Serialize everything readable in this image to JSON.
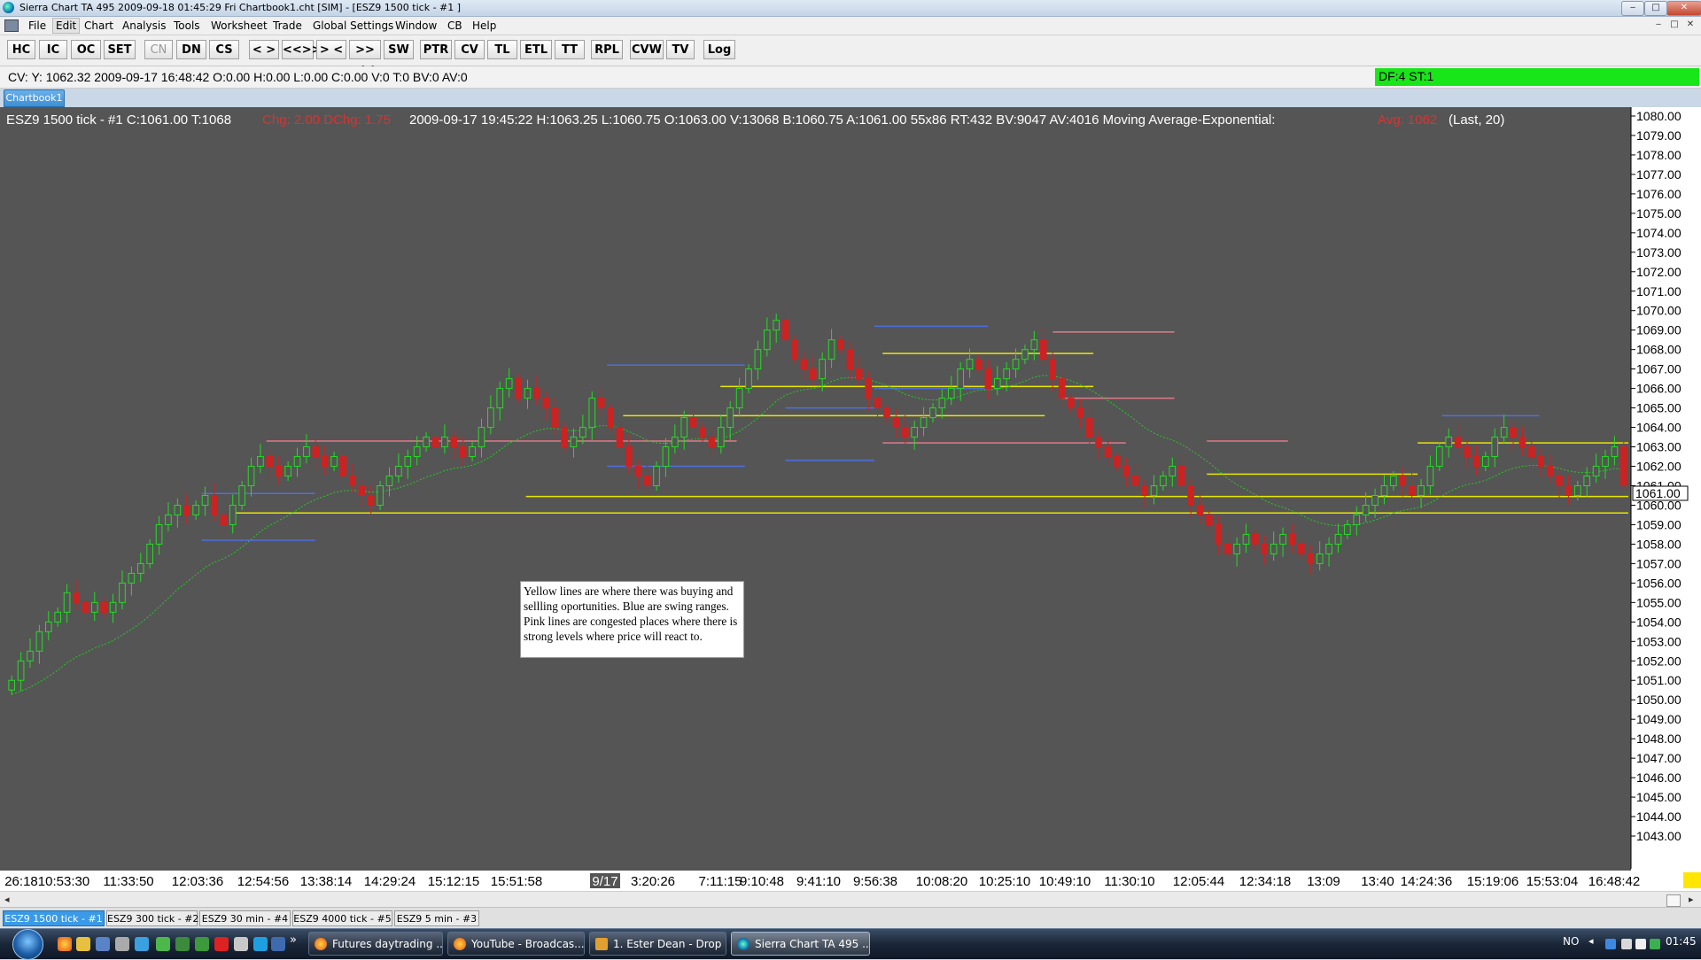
{
  "window": {
    "title": "Sierra Chart TA 495  2009-09-18  01:45:29  Fri   Chartbook1.cht [SIM] - [ESZ9  1500 tick - #1 ]",
    "controls": [
      "‒",
      "□",
      "✕"
    ]
  },
  "menu": [
    "File",
    "Edit",
    "Chart",
    "Analysis",
    "Tools",
    "Worksheet",
    "Trade",
    "Global Settings",
    "Window",
    "CB",
    "Help"
  ],
  "toolbar": {
    "buttons": [
      {
        "label": "HC",
        "enabled": true
      },
      {
        "label": "IC",
        "enabled": true
      },
      {
        "label": "OC",
        "enabled": true
      },
      {
        "label": "SET",
        "enabled": true
      },
      {
        "label": "CN",
        "enabled": false
      },
      {
        "label": "DN",
        "enabled": true
      },
      {
        "label": "CS",
        "enabled": true
      },
      {
        "label": "< >",
        "enabled": true
      },
      {
        "label": "<<>>",
        "enabled": true
      },
      {
        "label": "> <",
        "enabled": true
      },
      {
        "label": ">><<",
        "enabled": true
      },
      {
        "label": "SW",
        "enabled": true
      },
      {
        "label": "PTR",
        "enabled": true
      },
      {
        "label": "CV",
        "enabled": true
      },
      {
        "label": "TL",
        "enabled": true
      },
      {
        "label": "ETL",
        "enabled": true
      },
      {
        "label": "TT",
        "enabled": true
      },
      {
        "label": "RPL",
        "enabled": true
      },
      {
        "label": "CVW",
        "enabled": true
      },
      {
        "label": "TV",
        "enabled": true
      },
      {
        "label": "Log",
        "enabled": true
      }
    ]
  },
  "cursor_values": "CV: Y: 1062.32  2009-09-17   16:48:42  O:0.00  H:0.00  L:0.00  C:0.00  V:0  T:0  BV:0  AV:0",
  "status_indicator": "DF:4  ST:1",
  "chartbook_tab": "Chartbook1",
  "chart_header": {
    "symbol_info": "ESZ9  1500 tick - #1  C:1061.00  T:1068",
    "change": "Chg: 2.00  DChg: 1.75",
    "bar_info": "2009-09-17  19:45:22  H:1063.25  L:1060.75  O:1063.00  V:13068  B:1060.75  A:1061.00  55x86  RT:432  BV:9047  AV:4016  Moving Average-Exponential:",
    "study_value": "Avg: 1062",
    "study_params": "(Last, 20)"
  },
  "annotation": "Yellow lines are where there was buying and sellling oportunities. Blue are swing ranges. Pink lines are congested places where there is strong levels where price will react to.",
  "current_price_label": "1061.00",
  "colors": {
    "background": "#555555",
    "up_candle": "#22dd22",
    "down_candle": "#cc2222",
    "moving_average": "#22cc22",
    "yellow_lines": "#e6e600",
    "blue_lines": "#4d6fe0",
    "pink_lines": "#e07a8a",
    "status_green": "#19e619"
  },
  "chart_data": {
    "type": "candlestick",
    "symbol": "ESZ9",
    "ylim": [
      1042,
      1080
    ],
    "y_ticks": [
      "1080.00",
      "1079.00",
      "1078.00",
      "1077.00",
      "1076.00",
      "1075.00",
      "1074.00",
      "1073.00",
      "1072.00",
      "1071.00",
      "1070.00",
      "1069.00",
      "1068.00",
      "1067.00",
      "1066.00",
      "1065.00",
      "1064.00",
      "1063.00",
      "1062.00",
      "1061.00",
      "1060.00",
      "1059.00",
      "1058.00",
      "1057.00",
      "1056.00",
      "1055.00",
      "1054.00",
      "1053.00",
      "1052.00",
      "1051.00",
      "1050.00",
      "1049.00",
      "1048.00",
      "1047.00",
      "1046.00",
      "1045.00",
      "1044.00",
      "1043.00"
    ],
    "x_ticks": [
      "26:18",
      "10:53:30",
      "11:33:50",
      "12:03:36",
      "12:54:56",
      "13:38:14",
      "14:29:24",
      "15:12:15",
      "15:51:58",
      "9/17",
      "3:20:26",
      "7:11:15",
      "9:10:48",
      "9:41:10",
      "9:56:38",
      "10:08:20",
      "10:25:10",
      "10:49:10",
      "11:30:10",
      "12:05:44",
      "12:34:18",
      "13:09",
      "13:40",
      "14:24:36",
      "15:19:06",
      "15:53:04",
      "16:48:42"
    ],
    "close_path": [
      1051,
      1052,
      1052.5,
      1053.5,
      1054,
      1054.5,
      1055.5,
      1055,
      1054.5,
      1055,
      1054.5,
      1055,
      1056,
      1056.5,
      1057,
      1058,
      1059,
      1059.5,
      1060,
      1059.5,
      1060,
      1060.5,
      1059.5,
      1059,
      1060,
      1061,
      1062,
      1062.5,
      1062,
      1061.5,
      1062,
      1062.5,
      1063,
      1062.5,
      1062,
      1062.5,
      1061.5,
      1061,
      1060.5,
      1060,
      1061,
      1061.5,
      1062,
      1062.5,
      1063,
      1063.5,
      1063,
      1063.5,
      1063,
      1062.5,
      1063,
      1064,
      1065,
      1066,
      1066.5,
      1065.5,
      1066,
      1065.5,
      1065,
      1064,
      1063,
      1063.5,
      1064,
      1065.5,
      1065,
      1064,
      1063,
      1062,
      1061.5,
      1061,
      1062,
      1063,
      1063.5,
      1064.5,
      1064,
      1063.5,
      1063,
      1064,
      1065,
      1066,
      1067,
      1068,
      1069,
      1069.5,
      1068.5,
      1067.5,
      1067,
      1066.5,
      1067.5,
      1068.5,
      1068,
      1067,
      1066.5,
      1065.5,
      1065,
      1064.5,
      1064,
      1063.5,
      1064,
      1064.5,
      1065,
      1065.5,
      1066,
      1067,
      1067.5,
      1067,
      1066,
      1066.5,
      1067,
      1067.5,
      1068,
      1068.5,
      1067.5,
      1066.5,
      1065.5,
      1065,
      1064.5,
      1063.5,
      1063,
      1062.5,
      1062,
      1061.5,
      1061,
      1060.5,
      1061,
      1061.5,
      1062,
      1061,
      1060,
      1059.5,
      1059,
      1058,
      1057.5,
      1058,
      1058.5,
      1058,
      1057.5,
      1058,
      1058.5,
      1058,
      1057.5,
      1057,
      1057.5,
      1058,
      1058.5,
      1059,
      1059.5,
      1060,
      1060.5,
      1061,
      1061.5,
      1061,
      1060.5,
      1061,
      1062,
      1063,
      1063.5,
      1063,
      1062.5,
      1062,
      1062.5,
      1063.5,
      1064,
      1063.5,
      1063,
      1062.5,
      1062,
      1061.5,
      1061,
      1060.5,
      1061,
      1061.5,
      1062,
      1062.5,
      1063,
      1061
    ],
    "horizontal_lines": [
      {
        "color": "yellow",
        "price": 1060.45,
        "x_from": 0.32,
        "x_to": 1.0
      },
      {
        "color": "yellow",
        "price": 1059.6,
        "x_from": 0.14,
        "x_to": 1.0
      },
      {
        "color": "yellow",
        "price": 1064.6,
        "x_from": 0.38,
        "x_to": 0.64
      },
      {
        "color": "yellow",
        "price": 1066.1,
        "x_from": 0.44,
        "x_to": 0.67
      },
      {
        "color": "yellow",
        "price": 1067.8,
        "x_from": 0.54,
        "x_to": 0.67
      },
      {
        "color": "yellow",
        "price": 1063.2,
        "x_from": 0.87,
        "x_to": 1.0
      },
      {
        "color": "yellow",
        "price": 1061.6,
        "x_from": 0.74,
        "x_to": 0.87
      },
      {
        "color": "pink",
        "price": 1063.3,
        "x_from": 0.16,
        "x_to": 0.45
      },
      {
        "color": "pink",
        "price": 1063.2,
        "x_from": 0.54,
        "x_to": 0.69
      },
      {
        "color": "pink",
        "price": 1068.9,
        "x_from": 0.645,
        "x_to": 0.72
      },
      {
        "color": "pink",
        "price": 1065.5,
        "x_from": 0.65,
        "x_to": 0.72
      },
      {
        "color": "pink",
        "price": 1063.3,
        "x_from": 0.74,
        "x_to": 0.79
      },
      {
        "color": "blue",
        "price": 1067.2,
        "x_from": 0.37,
        "x_to": 0.455
      },
      {
        "color": "blue",
        "price": 1062.0,
        "x_from": 0.37,
        "x_to": 0.455
      },
      {
        "color": "blue",
        "price": 1060.6,
        "x_from": 0.12,
        "x_to": 0.19
      },
      {
        "color": "blue",
        "price": 1058.2,
        "x_from": 0.12,
        "x_to": 0.19
      },
      {
        "color": "blue",
        "price": 1069.2,
        "x_from": 0.535,
        "x_to": 0.605
      },
      {
        "color": "blue",
        "price": 1066.0,
        "x_from": 0.535,
        "x_to": 0.605
      },
      {
        "color": "blue",
        "price": 1065.0,
        "x_from": 0.48,
        "x_to": 0.535
      },
      {
        "color": "blue",
        "price": 1062.3,
        "x_from": 0.48,
        "x_to": 0.535
      },
      {
        "color": "blue",
        "price": 1064.6,
        "x_from": 0.885,
        "x_to": 0.945
      }
    ]
  },
  "chart_tabs": [
    "ESZ9  1500 tick - #1",
    "ESZ9  300 tick - #2",
    "ESZ9  30 min  - #4",
    "ESZ9  4000 tick - #5",
    "ESZ9  5 min  - #3"
  ],
  "taskbar": {
    "tasks": [
      "Futures daytrading ...",
      "YouTube - Broadcas...",
      "1. Ester Dean - Drop ...",
      "Sierra Chart TA 495   ..."
    ],
    "tray_lang": "NO",
    "clock": "01:45"
  }
}
